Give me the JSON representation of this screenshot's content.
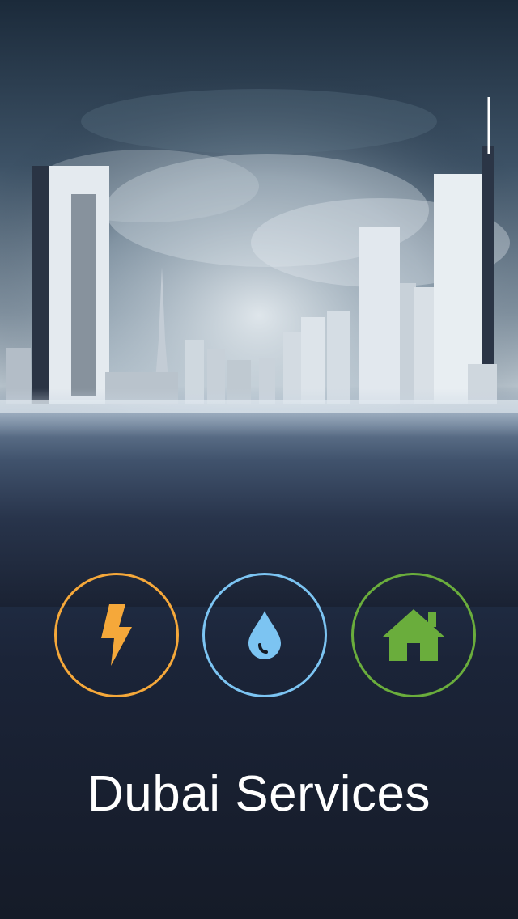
{
  "app": {
    "title": "Dubai Services"
  },
  "background": {
    "scene": "city-skyline-photo"
  },
  "services": [
    {
      "id": "electricity",
      "icon": "lightning-bolt-icon",
      "color": "#f5a83a"
    },
    {
      "id": "water",
      "icon": "water-drop-icon",
      "color": "#7cc4f2"
    },
    {
      "id": "housing",
      "icon": "house-icon",
      "color": "#6aad3c"
    }
  ]
}
